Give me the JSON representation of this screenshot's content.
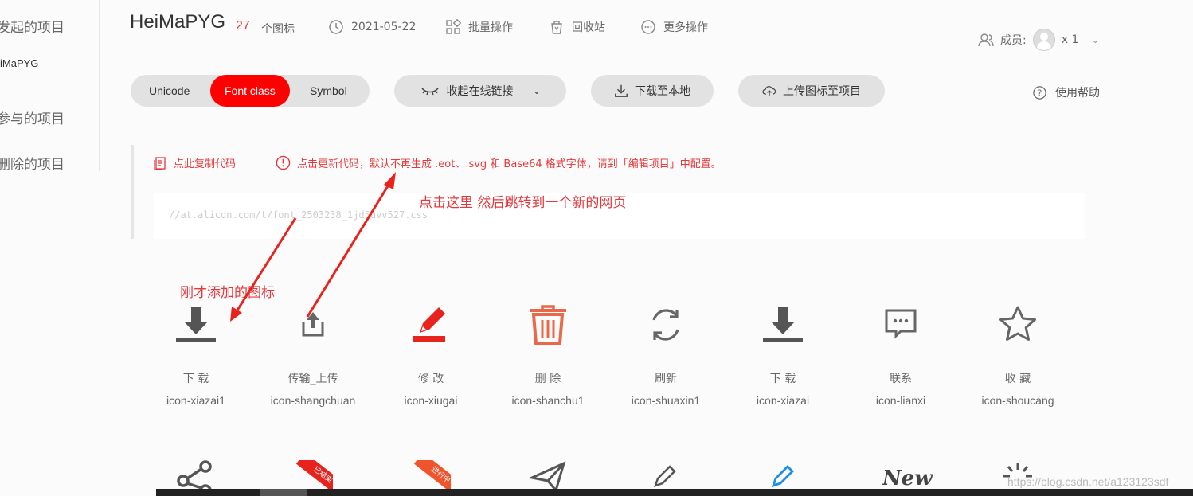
{
  "sidebar": {
    "items": [
      {
        "label": "发起的项目"
      },
      {
        "label": "iMaPYG"
      },
      {
        "label": "参与的项目"
      },
      {
        "label": "删除的项目"
      }
    ]
  },
  "header": {
    "project_name": "HeiMaPYG",
    "icon_count": "27",
    "icon_count_unit": "个图标",
    "date": "2021-05-22",
    "batch": "批量操作",
    "recycle": "回收站",
    "more": "更多操作",
    "members_label": "成员:",
    "members_count": "x 1"
  },
  "toolbar": {
    "tabs": [
      "Unicode",
      "Font class",
      "Symbol"
    ],
    "active_tab": "Font class",
    "collapse_link": "收起在线链接",
    "download": "下载至本地",
    "upload": "上传图标至项目",
    "help": "使用帮助"
  },
  "code": {
    "copy": "点此复制代码",
    "notice": "点击更新代码，默认不再生成 .eot、.svg 和 Base64 格式字体，请到「编辑项目」中配置。",
    "url": "//at.alicdn.com/t/font_2503238_1jd5uvv527.css"
  },
  "annotations": {
    "click_here": "点击这里  然后跳转到一个新的网页",
    "just_added": "刚才添加的图标"
  },
  "icons": [
    {
      "name": "下 载",
      "code": "icon-xiazai1",
      "glyph": "download-icon",
      "color": "#555555"
    },
    {
      "name": "传输_上传",
      "code": "icon-shangchuan",
      "glyph": "upload-icon",
      "color": "#666666"
    },
    {
      "name": "修 改",
      "code": "icon-xiugai",
      "glyph": "edit-icon",
      "color": "#e8231e"
    },
    {
      "name": "删 除",
      "code": "icon-shanchu1",
      "glyph": "trash-icon",
      "color": "#e8694a"
    },
    {
      "name": "刷新",
      "code": "icon-shuaxin1",
      "glyph": "refresh-icon",
      "color": "#666666"
    },
    {
      "name": "下 载",
      "code": "icon-xiazai",
      "glyph": "download-icon",
      "color": "#555555"
    },
    {
      "name": "联系",
      "code": "icon-lianxi",
      "glyph": "chat-icon",
      "color": "#666666"
    },
    {
      "name": "收 藏",
      "code": "icon-shoucang",
      "glyph": "star-icon",
      "color": "#666666"
    }
  ],
  "row2_badges": {
    "ended": "已结束",
    "in_progress": "进行中",
    "new_text": "New"
  },
  "watermark": "https://blog.csdn.net/a123123sdf",
  "colors": {
    "accent": "#ff0000",
    "notice": "#e4393c"
  }
}
